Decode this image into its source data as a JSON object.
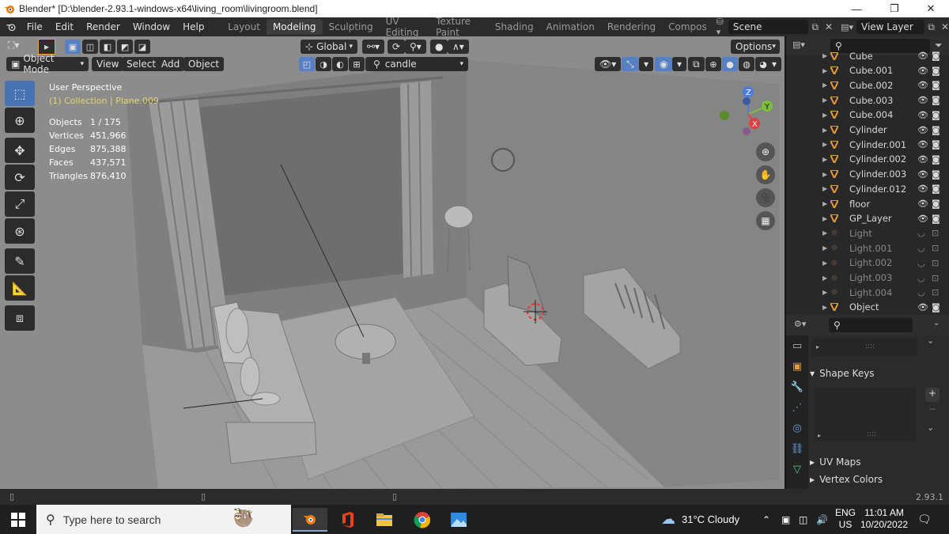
{
  "window": {
    "title": "Blender* [D:\\blender-2.93.1-windows-x64\\living_room\\livingroom.blend]",
    "minimize": "—",
    "maximize": "❐",
    "close": "✕"
  },
  "menus": [
    "File",
    "Edit",
    "Render",
    "Window",
    "Help"
  ],
  "workspace_tabs": [
    {
      "label": "Layout",
      "active": false
    },
    {
      "label": "Modeling",
      "active": true
    },
    {
      "label": "Sculpting",
      "active": false
    },
    {
      "label": "UV Editing",
      "active": false
    },
    {
      "label": "Texture Paint",
      "active": false
    },
    {
      "label": "Shading",
      "active": false
    },
    {
      "label": "Animation",
      "active": false
    },
    {
      "label": "Rendering",
      "active": false
    },
    {
      "label": "Compos",
      "active": false
    }
  ],
  "scene": {
    "name": "Scene",
    "view_layer": "View Layer"
  },
  "viewport_header": {
    "transform_orientation": "Global",
    "options_label": "Options",
    "mode": "Object Mode",
    "menus": [
      "View",
      "Select",
      "Add",
      "Object"
    ],
    "search_value": "candle"
  },
  "viewport": {
    "perspective": "User Perspective",
    "collection": "(1) Collection | Plane.009",
    "stats": [
      {
        "label": "Objects",
        "value": "1 / 175"
      },
      {
        "label": "Vertices",
        "value": "451,966"
      },
      {
        "label": "Edges",
        "value": "875,388"
      },
      {
        "label": "Faces",
        "value": "437,571"
      },
      {
        "label": "Triangles",
        "value": "876,410"
      }
    ],
    "gizmo": {
      "x": "X",
      "y": "Y",
      "z": "Z"
    }
  },
  "outliner": {
    "items": [
      {
        "name": "Cube",
        "kind": "mesh",
        "dim": false
      },
      {
        "name": "Cube.001",
        "kind": "mesh",
        "dim": false
      },
      {
        "name": "Cube.002",
        "kind": "mesh",
        "dim": false
      },
      {
        "name": "Cube.003",
        "kind": "mesh",
        "dim": false
      },
      {
        "name": "Cube.004",
        "kind": "mesh",
        "dim": false
      },
      {
        "name": "Cylinder",
        "kind": "mesh",
        "dim": false
      },
      {
        "name": "Cylinder.001",
        "kind": "mesh",
        "dim": false
      },
      {
        "name": "Cylinder.002",
        "kind": "mesh",
        "dim": false
      },
      {
        "name": "Cylinder.003",
        "kind": "mesh",
        "dim": false
      },
      {
        "name": "Cylinder.012",
        "kind": "mesh",
        "dim": false
      },
      {
        "name": "floor",
        "kind": "mesh",
        "dim": false
      },
      {
        "name": "GP_Layer",
        "kind": "mesh",
        "dim": false
      },
      {
        "name": "Light",
        "kind": "light",
        "dim": true
      },
      {
        "name": "Light.001",
        "kind": "light",
        "dim": true
      },
      {
        "name": "Light.002",
        "kind": "light",
        "dim": true
      },
      {
        "name": "Light.003",
        "kind": "light",
        "dim": true
      },
      {
        "name": "Light.004",
        "kind": "light",
        "dim": true
      },
      {
        "name": "Object",
        "kind": "mesh",
        "dim": false
      }
    ]
  },
  "properties": {
    "panels": [
      "Shape Keys",
      "UV Maps",
      "Vertex Colors"
    ],
    "dots": "::::"
  },
  "statusbar": {
    "version": "2.93.1"
  },
  "taskbar": {
    "search_placeholder": "Type here to search",
    "weather": "31°C  Cloudy",
    "lang_top": "ENG",
    "lang_bottom": "US",
    "time": "11:01 AM",
    "date": "10/20/2022"
  },
  "colors": {
    "accent": "#4772b3",
    "mesh_icon": "#e09a3a",
    "collection_text": "#e8d36a"
  }
}
